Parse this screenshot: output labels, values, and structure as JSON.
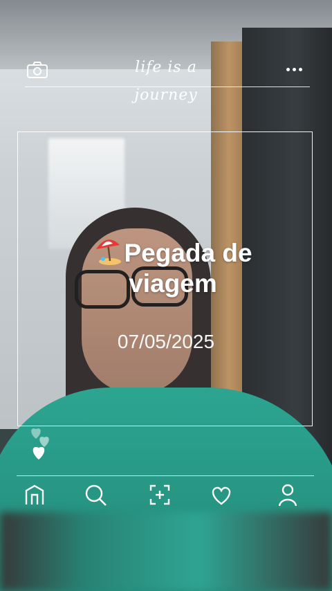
{
  "header": {
    "brand": "life is a journey",
    "camera_icon": "camera-icon",
    "more_icon": "more-dots-icon"
  },
  "card": {
    "title_line1": "Pegada de",
    "title_line2": "viagem",
    "title_emoji": "beach-umbrella-icon",
    "date": "07/05/2025"
  },
  "reactions": {
    "icon": "hearts-icon"
  },
  "nav": {
    "items": [
      {
        "icon": "home-icon"
      },
      {
        "icon": "search-icon"
      },
      {
        "icon": "add-frame-icon"
      },
      {
        "icon": "heart-icon"
      },
      {
        "icon": "profile-icon"
      }
    ]
  },
  "colors": {
    "overlay_text": "#ffffff",
    "shirt": "#1fa08a"
  }
}
